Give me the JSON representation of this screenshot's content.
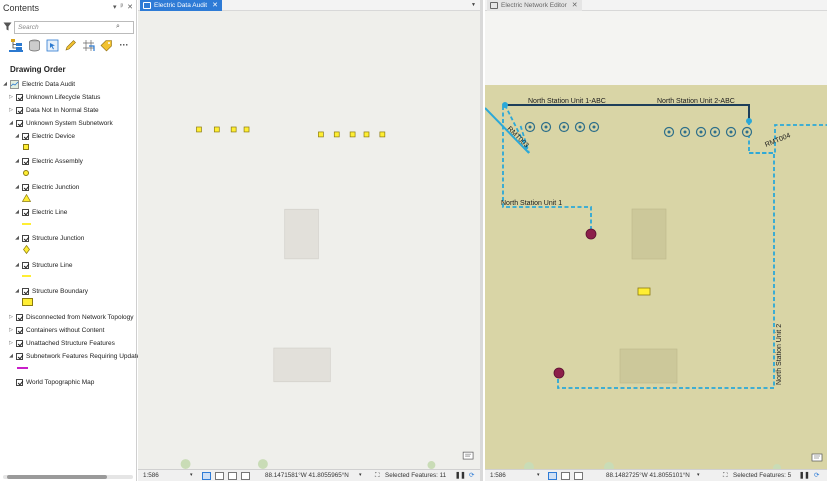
{
  "contents": {
    "title": "Contents",
    "pane_controls": [
      "▾",
      "ᵖ",
      "✕"
    ],
    "search_placeholder": "Search",
    "drawing_order_label": "Drawing Order",
    "map_name": "Electric Data Audit",
    "layers": [
      {
        "label": "Unknown Lifecycle Status"
      },
      {
        "label": "Data Not In Normal State"
      },
      {
        "label": "Unknown System Subnetwork"
      },
      {
        "label": "Electric Device"
      },
      {
        "label": "Electric Assembly"
      },
      {
        "label": "Electric Junction"
      },
      {
        "label": "Electric Line"
      },
      {
        "label": "Structure Junction"
      },
      {
        "label": "Structure Line"
      },
      {
        "label": "Structure Boundary"
      },
      {
        "label": "Disconnected from Network Topology"
      },
      {
        "label": "Containers without Content"
      },
      {
        "label": "Unattached Structure Features"
      },
      {
        "label": "Subnetwork Features Requiring Update"
      },
      {
        "label": "World Topographic Map"
      }
    ],
    "colors": {
      "symbol_yellow": "#ffee33",
      "subnetwork_magenta": "#c81ec8"
    }
  },
  "view1": {
    "tab_label": "Electric Data Audit",
    "tab_close": "✕",
    "scale": "1:586",
    "coordinates": "88.1471581°W 41.8055965°N",
    "selected_features": "Selected Features: 11"
  },
  "view2": {
    "tab_label": "Electric Network Editor",
    "tab_close": "✕",
    "scale": "1:586",
    "coordinates": "88.1482725°W 41.8055101°N",
    "selected_features": "Selected Features: 5",
    "map_labels": {
      "unit_1_abc": "North Station Unit 1-ABC",
      "unit_2_abc": "North Station Unit 2-ABC",
      "unit_1": "North Station Unit 1",
      "unit_2": "North Station Unit 2",
      "rmt003": "RMT003",
      "rmt004": "RMT004"
    },
    "colors": {
      "background": "#d9d5a6",
      "line_dark": "#1f3f5a",
      "line_dashed": "#2ba8d8",
      "device": "#8c1f4a"
    }
  }
}
